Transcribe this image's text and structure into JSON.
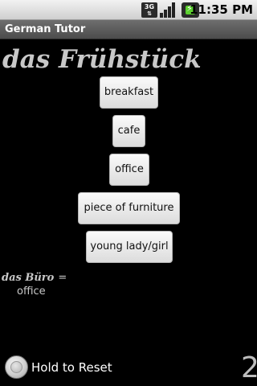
{
  "status_bar": {
    "network_type": "3G",
    "time": "11:35 PM",
    "icons": [
      "3g-data-icon",
      "signal-strength-icon",
      "battery-charging-icon"
    ],
    "battery_color": "#5cd12f"
  },
  "app": {
    "title": "German Tutor"
  },
  "quiz": {
    "word": "das Frühstück",
    "choices": [
      {
        "label": "breakfast"
      },
      {
        "label": "cafe"
      },
      {
        "label": "office"
      },
      {
        "label": "piece of furniture"
      },
      {
        "label": "young lady/girl"
      }
    ]
  },
  "previous": {
    "term": "das Büro",
    "equals": "=",
    "translation": "office"
  },
  "reset": {
    "label": "Hold to Reset"
  },
  "counter": {
    "value": "2"
  }
}
